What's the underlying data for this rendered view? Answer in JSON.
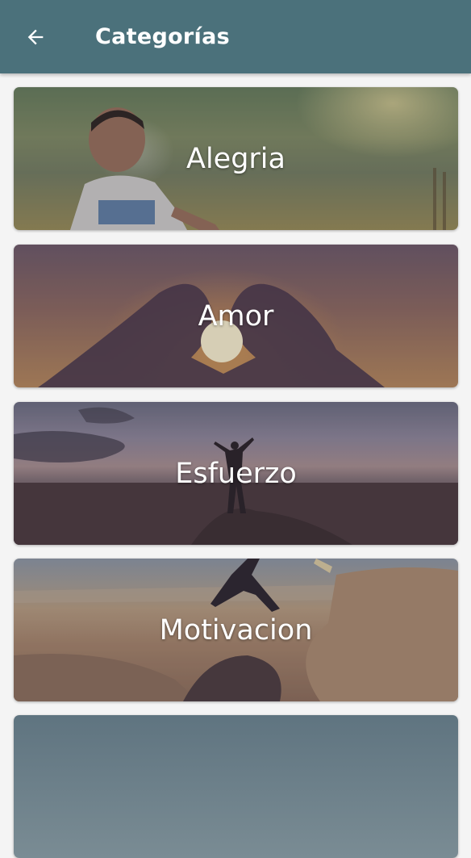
{
  "appbar": {
    "title": "Categorías",
    "back_icon": "arrow-left-icon",
    "color": "#4b717b"
  },
  "categories": [
    {
      "label": "Alegria"
    },
    {
      "label": "Amor"
    },
    {
      "label": "Esfuerzo"
    },
    {
      "label": "Motivacion"
    }
  ]
}
